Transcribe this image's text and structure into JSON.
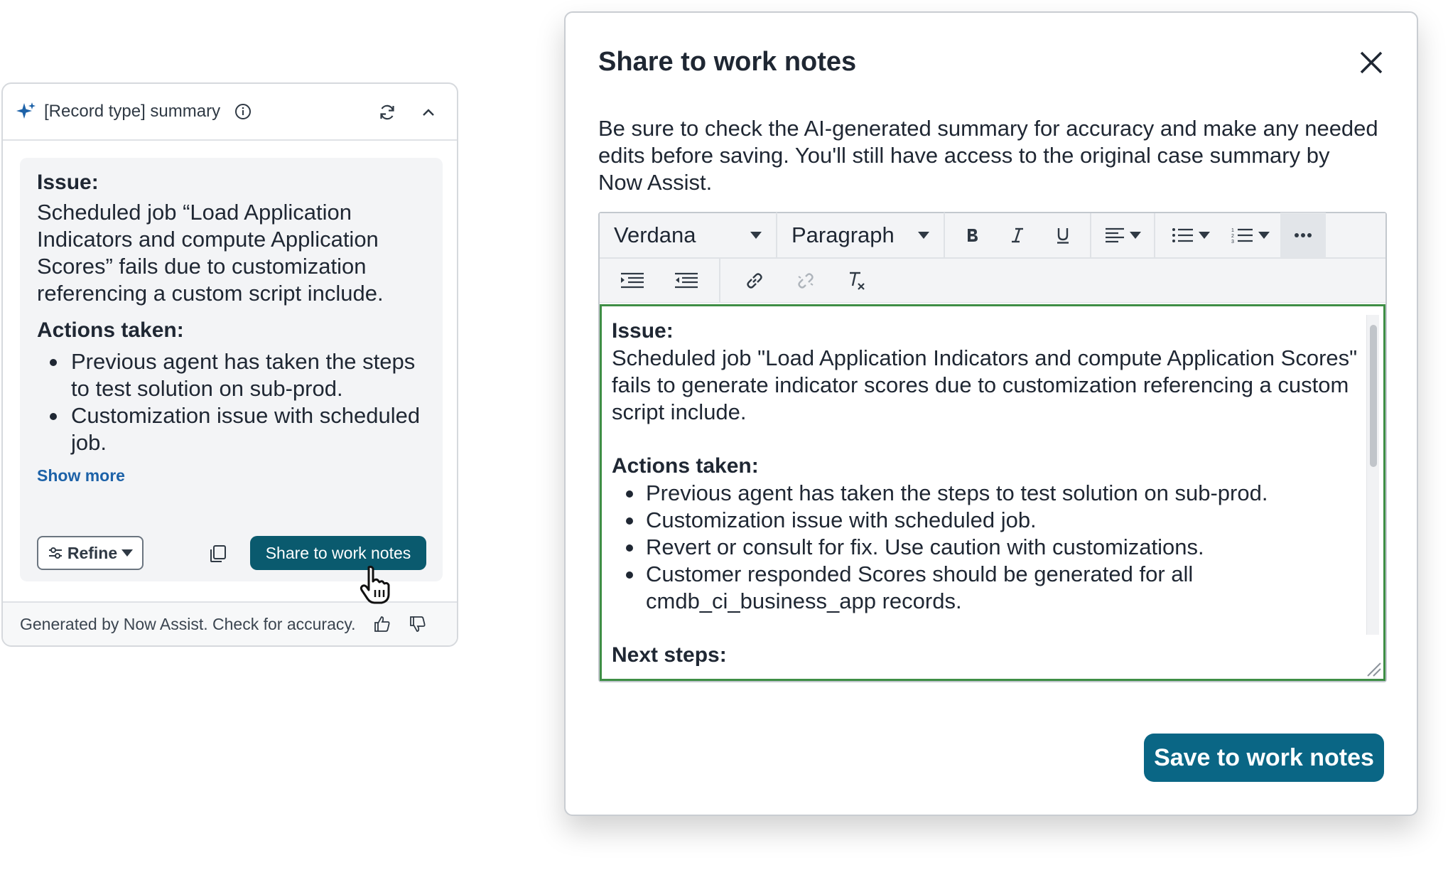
{
  "summary_card": {
    "title": "[Record type] summary",
    "icons": {
      "sparkle": "sparkle-icon",
      "info": "info-icon",
      "refresh": "refresh-icon",
      "collapse": "chevron-up-icon"
    },
    "issue_heading": "Issue:",
    "issue_text": "Scheduled job “Load Application Indicators and compute Application Scores” fails due to customization referencing a custom script include.",
    "actions_heading": "Actions taken:",
    "actions": [
      "Previous agent has taken the steps to test solution on sub-prod.",
      "Customization issue with scheduled job."
    ],
    "show_more": "Show more",
    "refine_label": "Refine",
    "share_label": "Share to work notes",
    "footer_text": "Generated by Now Assist. Check for accuracy."
  },
  "modal": {
    "title": "Share to work notes",
    "description": "Be sure to check the AI-generated summary for accuracy and make any needed edits before saving. You'll still have access to the original case summary by Now Assist.",
    "toolbar": {
      "font": "Verdana",
      "block_format": "Paragraph",
      "more_label": "···"
    },
    "editor": {
      "issue_heading": "Issue:",
      "issue_text": "Scheduled job \"Load Application Indicators and compute Application Scores\" fails to generate indicator scores due to customization referencing a custom script include.",
      "actions_heading": "Actions taken:",
      "actions": [
        "Previous agent has taken the steps to test solution on sub-prod.",
        "Customization issue with scheduled job.",
        "Revert or consult for fix. Use caution with customizations.",
        "Customer responded Scores should be generated for all cmdb_ci_business_app records."
      ],
      "next_heading": "Next steps:"
    },
    "save_label": "Save to work notes"
  },
  "colors": {
    "share_button": "#0a5a6e",
    "save_button": "#0a6685",
    "link": "#1d62a8",
    "editor_focus_border": "#3e8e45"
  }
}
